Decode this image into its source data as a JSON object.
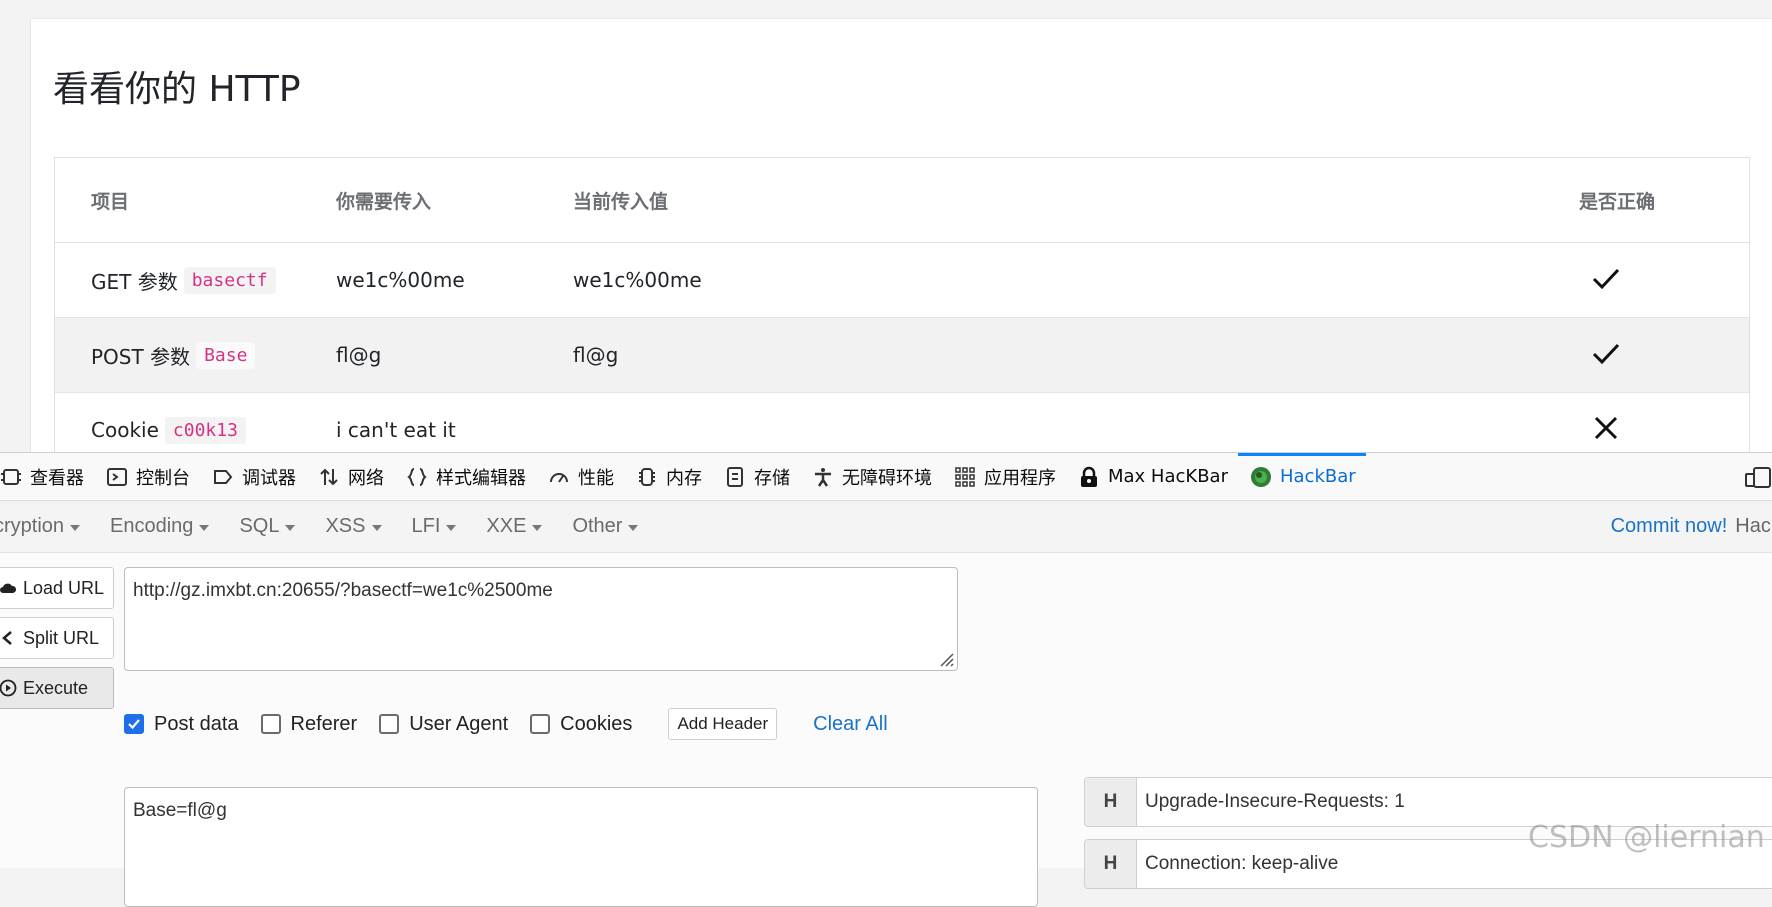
{
  "page": {
    "title": "看看你的 HTTP",
    "table": {
      "headers": [
        "项目",
        "你需要传入",
        "当前传入值",
        "是否正确"
      ],
      "rows": [
        {
          "label": "GET 参数",
          "param": "basectf",
          "required": "we1c%00me",
          "current": "we1c%00me",
          "ok": true
        },
        {
          "label": "POST 参数",
          "param": "Base",
          "required": "fl@g",
          "current": "fl@g",
          "ok": true
        },
        {
          "label": "Cookie",
          "param": "c00k13",
          "required": "i can't eat it",
          "current": "",
          "ok": false
        }
      ]
    }
  },
  "devtools": {
    "tabs": [
      {
        "label": "查看器",
        "icon": "inspector-icon"
      },
      {
        "label": "控制台",
        "icon": "console-icon"
      },
      {
        "label": "调试器",
        "icon": "debugger-icon"
      },
      {
        "label": "网络",
        "icon": "network-icon"
      },
      {
        "label": "样式编辑器",
        "icon": "style-editor-icon"
      },
      {
        "label": "性能",
        "icon": "performance-icon"
      },
      {
        "label": "内存",
        "icon": "memory-icon"
      },
      {
        "label": "存储",
        "icon": "storage-icon"
      },
      {
        "label": "无障碍环境",
        "icon": "accessibility-icon"
      },
      {
        "label": "应用程序",
        "icon": "application-icon"
      },
      {
        "label": "Max HacKBar",
        "icon": "max-hackbar-icon"
      },
      {
        "label": "HackBar",
        "icon": "hackbar-icon",
        "active": true
      }
    ]
  },
  "hackbar": {
    "menu": [
      "cryption",
      "Encoding",
      "SQL",
      "XSS",
      "LFI",
      "XXE",
      "Other"
    ],
    "commit_label": "Commit now!",
    "commit_suffix": "Hackb",
    "buttons": {
      "load": "Load URL",
      "split": "Split URL",
      "execute": "Execute"
    },
    "url": "http://gz.imxbt.cn:20655/?basectf=we1c%2500me",
    "checks": [
      {
        "label": "Post data",
        "checked": true
      },
      {
        "label": "Referer",
        "checked": false
      },
      {
        "label": "User Agent",
        "checked": false
      },
      {
        "label": "Cookies",
        "checked": false
      }
    ],
    "add_header": "Add Header",
    "clear_all": "Clear All",
    "post_body": "Base=fl@g",
    "headers": [
      {
        "tag": "H",
        "value": "Upgrade-Insecure-Requests: 1"
      },
      {
        "tag": "H",
        "value": "Connection: keep-alive"
      }
    ]
  },
  "watermark": "CSDN @liernian",
  "colors": {
    "code": "#d63384",
    "active_tab": "#0a84ff",
    "link": "#1a73c9",
    "checkbox": "#1f6feb"
  }
}
